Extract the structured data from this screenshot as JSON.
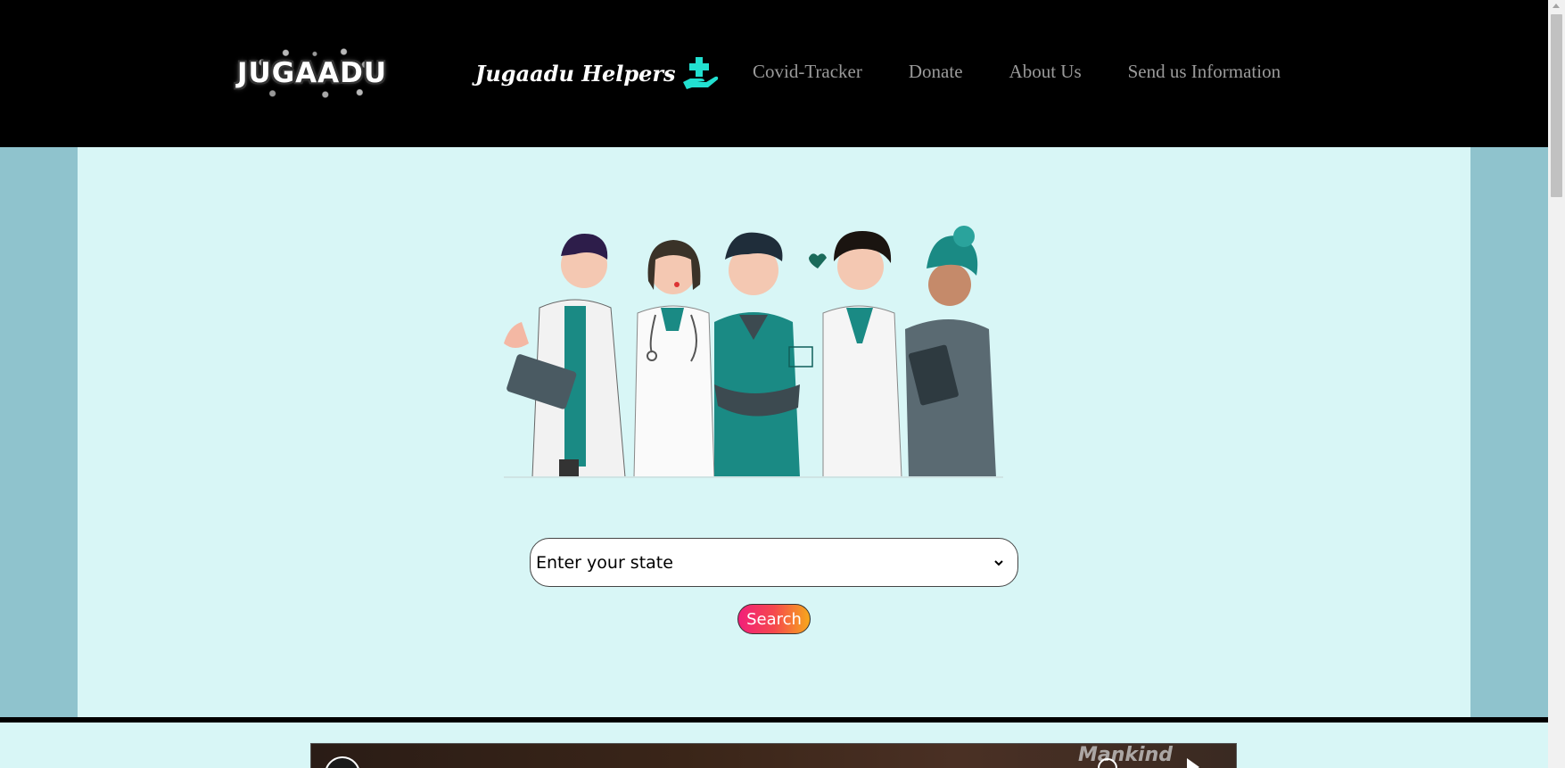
{
  "header": {
    "logo_text": "JUGAADU",
    "brand_title": "Jugaadu Helpers",
    "brand_icon": "hand-medical-cross-icon",
    "nav": [
      {
        "label": "Covid-Tracker"
      },
      {
        "label": "Donate"
      },
      {
        "label": "About Us"
      },
      {
        "label": "Send us Information"
      }
    ]
  },
  "hero": {
    "illustration": "healthcare-workers-group",
    "state_select": {
      "selected": "Enter your state"
    },
    "search_label": "Search"
  },
  "video": {
    "watermark": "Mankind"
  },
  "colors": {
    "header_bg": "#000000",
    "page_bg": "#8fc3cd",
    "hero_bg": "#d8f6f6",
    "nav_text": "#9a9a9a",
    "brand_icon": "#22e0d0",
    "search_gradient_start": "#f21f7a",
    "search_gradient_end": "#f7a81c",
    "scrub_teal": "#1a8a84"
  }
}
